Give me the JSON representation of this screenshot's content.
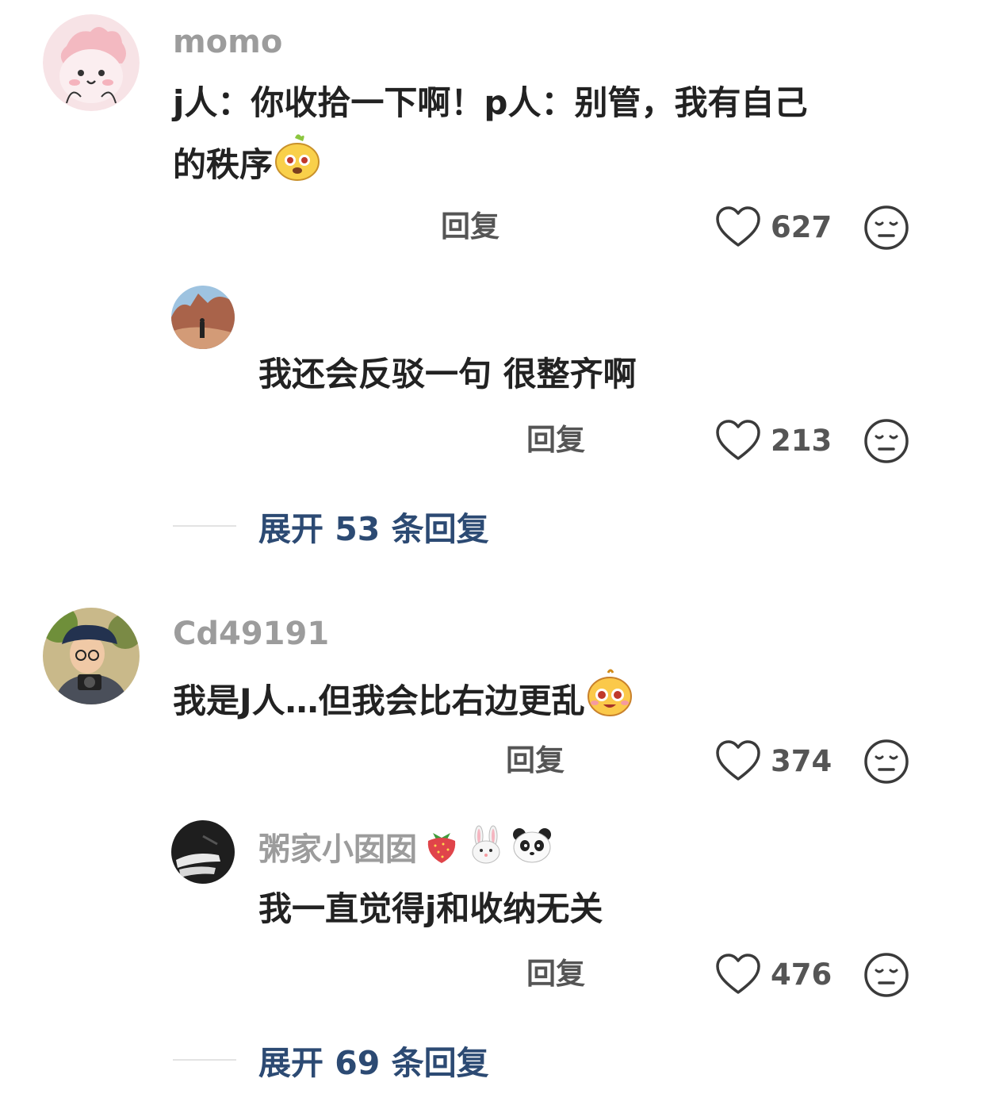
{
  "comments": [
    {
      "username": "momo",
      "text_line1": "j人：你收拾一下啊！p人：别管，我有自己",
      "text_line2": "的秩序",
      "reply_label": "回复",
      "likes": "627",
      "replies": [
        {
          "text": "我还会反驳一句 很整齐啊",
          "reply_label": "回复",
          "likes": "213"
        }
      ],
      "expand_label": "展开 53 条回复"
    },
    {
      "username": "Cd49191",
      "text": "我是J人…但我会比右边更乱",
      "reply_label": "回复",
      "likes": "374",
      "replies": [
        {
          "username": "粥家小囡囡",
          "text": "我一直觉得j和收纳无关",
          "reply_label": "回复",
          "likes": "476"
        }
      ],
      "expand_label": "展开 69 条回复"
    }
  ],
  "icons": {
    "like": "heart-outline-icon",
    "dislike": "neutral-face-icon"
  },
  "colors": {
    "username": "#9c9c9c",
    "expand_link": "#2c4a73",
    "text": "#222222",
    "meta": "#555555"
  }
}
